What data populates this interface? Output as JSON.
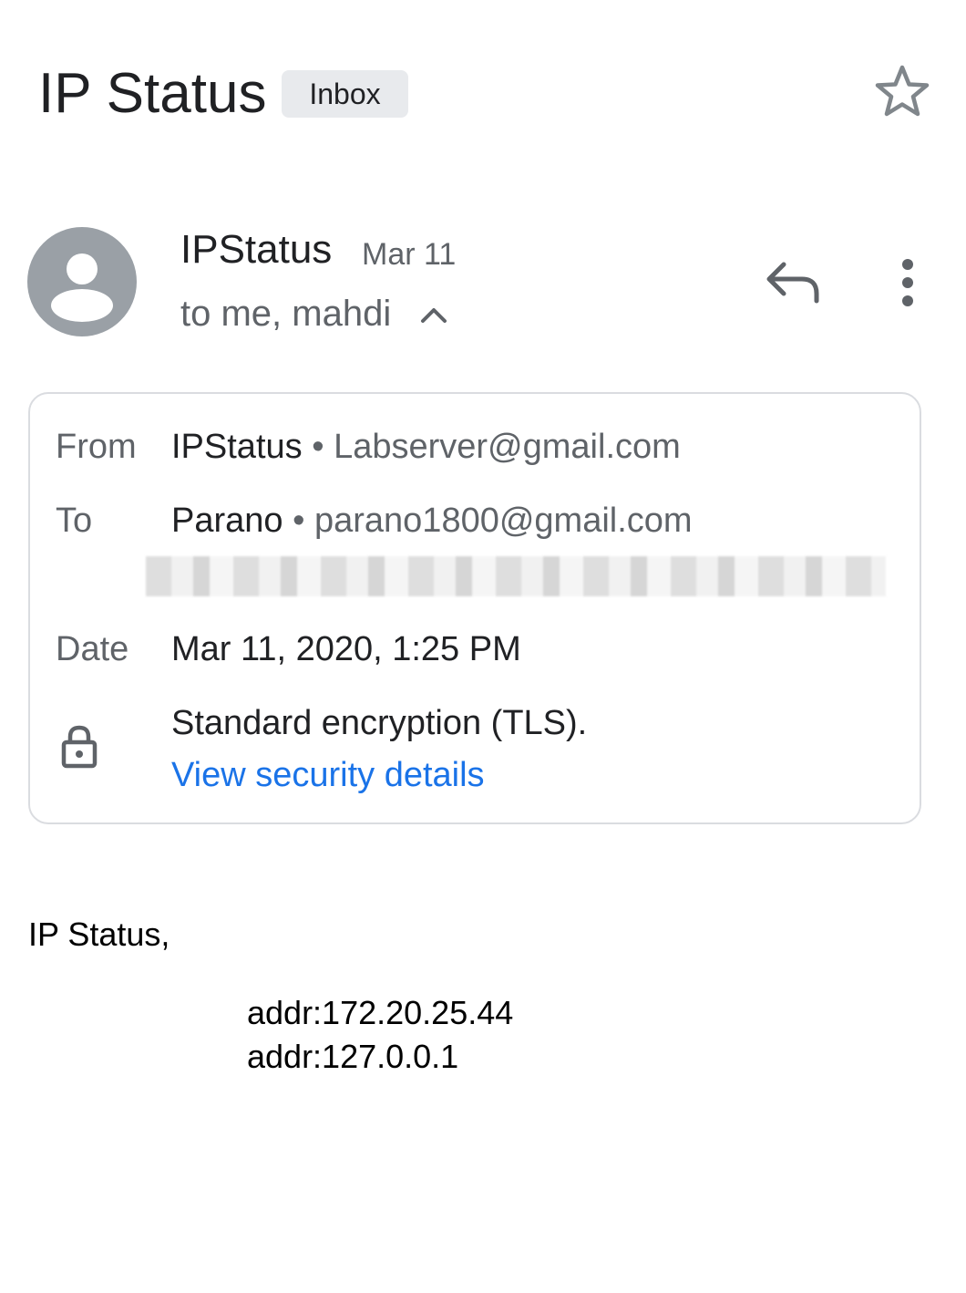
{
  "header": {
    "subject": "IP Status",
    "label": "Inbox",
    "star_icon": "star-outline-icon"
  },
  "message": {
    "sender_name": "IPStatus",
    "date_short": "Mar 11",
    "recipients": "to me, mahdi",
    "avatar_icon": "person-avatar-icon",
    "reply_icon": "reply-icon",
    "more_icon": "more-vert-icon"
  },
  "details": {
    "from_label": "From",
    "from_name": "IPStatus",
    "from_separator": "•",
    "from_email": "Labserver@gmail.com",
    "to_label": "To",
    "to_name": "Parano",
    "to_separator": "•",
    "to_email": "parano1800@gmail.com",
    "date_label": "Date",
    "date_value": "Mar 11, 2020, 1:25 PM",
    "security_text": "Standard encryption (TLS).",
    "security_link": "View security details"
  },
  "body": {
    "greeting": "IP Status,",
    "lines": [
      "addr:172.20.25.44",
      "addr:127.0.0.1"
    ]
  },
  "colors": {
    "text_primary": "#202124",
    "text_secondary": "#5f6368",
    "link": "#1a73e8",
    "chip_bg": "#e8eaed",
    "avatar_bg": "#9aa0a6",
    "border": "#dadce0"
  }
}
